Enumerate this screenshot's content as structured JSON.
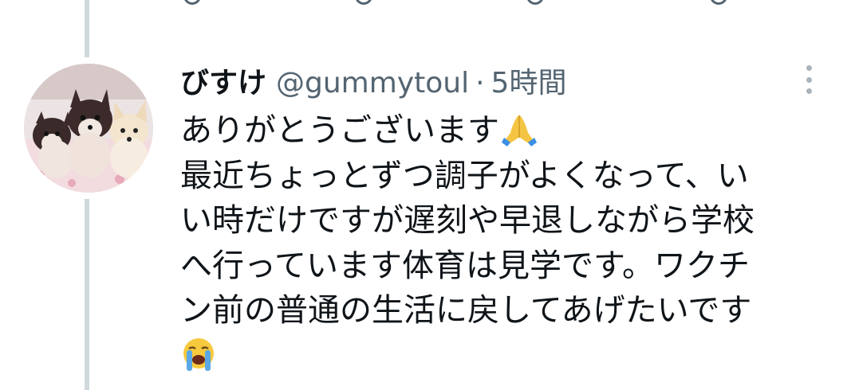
{
  "tweet": {
    "author_name": "びすけ",
    "handle": "@gummytoul",
    "separator": "·",
    "timestamp": "5時間",
    "text_lines": [
      "ありがとうございます",
      "最近ちょっとずつ調子がよくなって、い",
      "い時だけですが遅刻や早退しながら学校",
      "へ行っています体育は見学です。ワクチ",
      "ン前の普通の生活に戻してあげたいです",
      ""
    ],
    "emojis": [
      "folded-hands",
      "loudly-crying-face"
    ]
  },
  "colors": {
    "text_primary": "#0f1419",
    "text_secondary": "#536471",
    "thread_line": "#cfd9de",
    "more_dots": "#a9b3bb"
  }
}
